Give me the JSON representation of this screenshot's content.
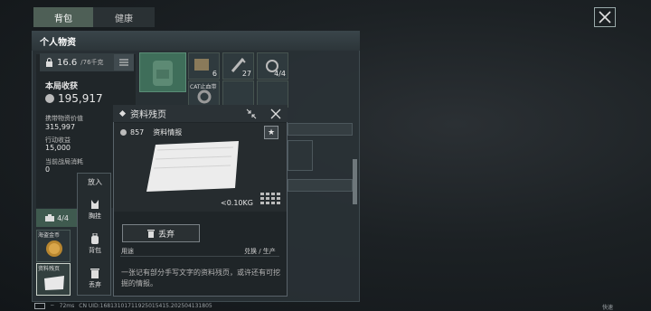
{
  "tabs": [
    {
      "label": "背包"
    },
    {
      "label": "健康"
    }
  ],
  "panel": {
    "title": "个人物资"
  },
  "weight": {
    "current": "16.6",
    "max": "/76千克"
  },
  "stats": {
    "round_income_label": "本局收获",
    "round_income_value": "195,917",
    "carry_value_label": "携带物资价值",
    "carry_value": "315,997",
    "action_income_label": "行动收益",
    "action_income": "15,000",
    "battle_cost_label": "当前战局消耗",
    "battle_cost": "0"
  },
  "grid": {
    "count_6": "6",
    "count_27": "27",
    "count_4_4": "4/4",
    "cat_label": "CAT止血带"
  },
  "pouch": {
    "count": "4/4"
  },
  "items": {
    "coin_label": "海盗金币",
    "doc_label": "资料残页"
  },
  "sidemenu": {
    "header": "放入",
    "items": [
      {
        "label": "胸挂"
      },
      {
        "label": "背包"
      },
      {
        "label": "丢弃"
      }
    ]
  },
  "popup": {
    "title": "资料残页",
    "price": "857",
    "category": "资料情报",
    "weight": "<0.10KG",
    "discard_label": "丢弃",
    "use_label": "用途",
    "use_value": "兑换 / 生产",
    "description": "一张记有部分手写文字的资料残页，或许还有可挖掘的情报。"
  },
  "footer": {
    "ping": "72ms",
    "uid": "CN UID:16813101711925015415.202504131805"
  },
  "right_tag": "快速",
  "colors": {
    "tab_active": "#4e5f56",
    "accent_green": "#4a7a60",
    "panel_bg": "#2a3237"
  }
}
